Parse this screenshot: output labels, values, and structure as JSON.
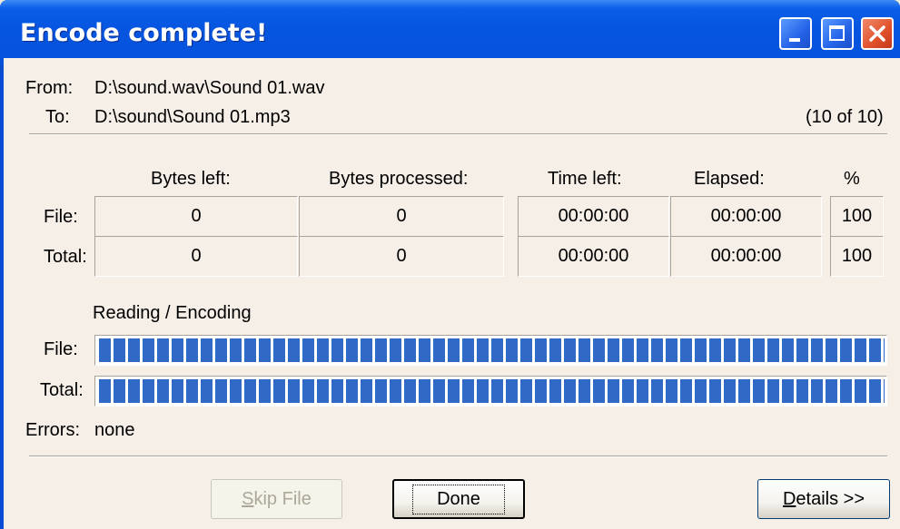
{
  "window": {
    "title": "Encode complete!"
  },
  "paths": {
    "from_label": "From:",
    "from_value": "D:\\sound.wav\\Sound 01.wav",
    "to_label": "To:",
    "to_value": "D:\\sound\\Sound 01.mp3",
    "counter": "(10 of 10)"
  },
  "stats": {
    "headers": {
      "bytes_left": "Bytes left:",
      "bytes_processed": "Bytes processed:",
      "time_left": "Time left:",
      "elapsed": "Elapsed:",
      "percent": "%"
    },
    "file": {
      "label": "File:",
      "bytes_left": "0",
      "bytes_processed": "0",
      "time_left": "00:00:00",
      "elapsed": "00:00:00",
      "percent": "100"
    },
    "total": {
      "label": "Total:",
      "bytes_left": "0",
      "bytes_processed": "0",
      "time_left": "00:00:00",
      "elapsed": "00:00:00",
      "percent": "100"
    }
  },
  "progress": {
    "section_label": "Reading / Encoding",
    "file_label": "File:",
    "file_fraction": 1.0,
    "total_label": "Total:",
    "total_fraction": 1.0
  },
  "errors": {
    "label": "Errors:",
    "value": "none"
  },
  "buttons": {
    "skip_file_accel": "S",
    "skip_file_rest": "kip File",
    "done": "Done",
    "details_accel": "D",
    "details_rest": "etails >>"
  },
  "colors": {
    "title_bar": "#0655e0",
    "progress_fill": "#3169c6",
    "client_bg": "#f5efe8",
    "close_button": "#e0502a"
  },
  "icons": [
    "minimize-icon",
    "maximize-icon",
    "close-icon"
  ]
}
